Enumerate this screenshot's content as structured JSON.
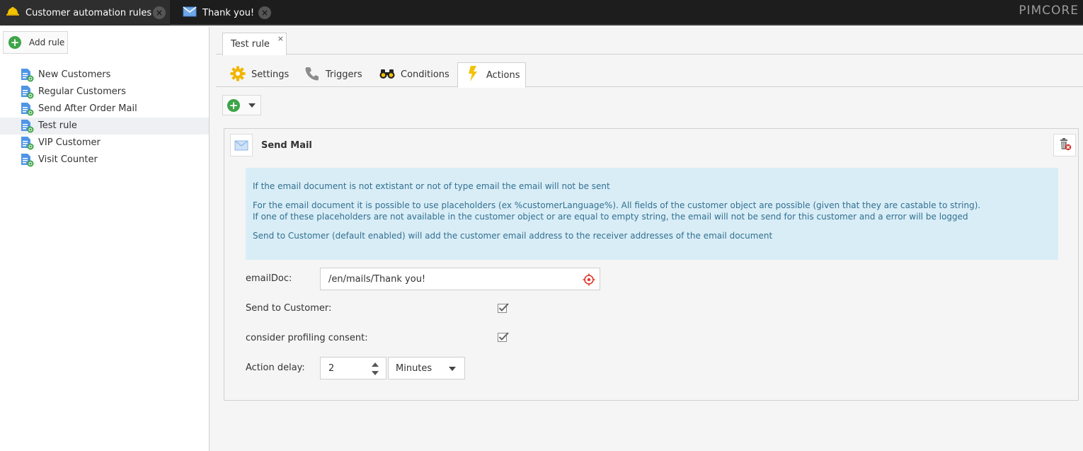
{
  "topbar": {
    "tabs": [
      {
        "label": "Customer automation rules",
        "icon": "hard-hat-icon"
      },
      {
        "label": "Thank you!",
        "icon": "email-icon"
      }
    ],
    "logo": "PIMCORE"
  },
  "sidebar": {
    "add_label": "Add rule",
    "items": [
      {
        "label": "New Customers"
      },
      {
        "label": "Regular Customers"
      },
      {
        "label": "Send After Order Mail"
      },
      {
        "label": "Test rule"
      },
      {
        "label": "VIP Customer"
      },
      {
        "label": "Visit Counter"
      }
    ],
    "selected": "Test rule"
  },
  "editor": {
    "rule_tab": "Test rule",
    "rule_tab_close": "×",
    "subtabs": [
      {
        "label": "Settings",
        "icon": "gear-icon"
      },
      {
        "label": "Triggers",
        "icon": "phone-icon"
      },
      {
        "label": "Conditions",
        "icon": "binoculars-icon"
      },
      {
        "label": "Actions",
        "icon": "lightning-icon"
      }
    ],
    "active_subtab": "Actions"
  },
  "action": {
    "title": "Send Mail",
    "info": {
      "line1": "If the email document is not extistant or not of type email the email will not be sent",
      "line2": "For the email document it is possible to use placeholders (ex %customerLanguage%). All fields of the customer object are possible (given that they are castable to string).",
      "line3": "If one of these placeholders are not available in the customer object or are equal to empty string, the email will not be send for this customer and a error will be logged",
      "line4": "Send to Customer (default enabled) will add the customer email address to the receiver addresses of the email document"
    },
    "fields": {
      "email_doc_label": "emailDoc:",
      "email_doc_value": "/en/mails/Thank you!",
      "send_to_customer_label": "Send to Customer:",
      "send_to_customer_checked": true,
      "profiling_label": "consider profiling consent:",
      "profiling_checked": true,
      "delay_label": "Action delay:",
      "delay_value": "2",
      "delay_unit": "Minutes"
    }
  },
  "colors": {
    "accent_green": "#3ea548",
    "info_bg": "#d9edf7",
    "info_text": "#31708f",
    "topbar_bg": "#1d1d1d"
  }
}
